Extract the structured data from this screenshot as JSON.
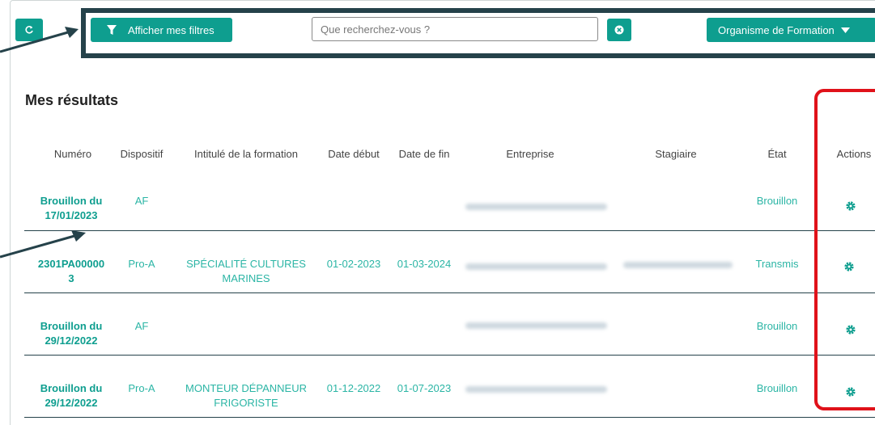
{
  "toolbar": {
    "filter_label": "Afficher mes filtres",
    "search_placeholder": "Que recherchez-vous ?",
    "org_label": "Organisme de Formation"
  },
  "page": {
    "title": "Mes résultats"
  },
  "table": {
    "headers": [
      "Numéro",
      "Dispositif",
      "Intitulé de la formation",
      "Date début",
      "Date de fin",
      "Entreprise",
      "Stagiaire",
      "État",
      "Actions"
    ],
    "rows": [
      {
        "numero_1": "Brouillon du",
        "numero_2": "17/01/2023",
        "dispositif": "AF",
        "intitule_1": "",
        "intitule_2": "",
        "date_debut": "",
        "date_fin": "",
        "etat": "Brouillon"
      },
      {
        "numero_1": "2301PA00000",
        "numero_2": "3",
        "dispositif": "Pro-A",
        "intitule_1": "SPÉCIALITÉ CULTURES",
        "intitule_2": "MARINES",
        "date_debut": "01-02-2023",
        "date_fin": "01-03-2024",
        "etat": "Transmis"
      },
      {
        "numero_1": "Brouillon du",
        "numero_2": "29/12/2022",
        "dispositif": "AF",
        "intitule_1": "",
        "intitule_2": "",
        "date_debut": "",
        "date_fin": "",
        "etat": "Brouillon"
      },
      {
        "numero_1": "Brouillon du",
        "numero_2": "29/12/2022",
        "dispositif": "Pro-A",
        "intitule_1": "MONTEUR DÉPANNEUR",
        "intitule_2": "FRIGORISTE",
        "date_debut": "01-12-2022",
        "date_fin": "01-07-2023",
        "etat": "Brouillon"
      }
    ]
  },
  "icons": {
    "refresh": "refresh-icon",
    "filter": "filter-icon",
    "clear": "clear-icon",
    "caret": "caret-down-icon",
    "settings": "gear-icon"
  },
  "colors": {
    "primary": "#0e9e8f",
    "frame": "#25424a",
    "highlight": "#e0121a"
  }
}
